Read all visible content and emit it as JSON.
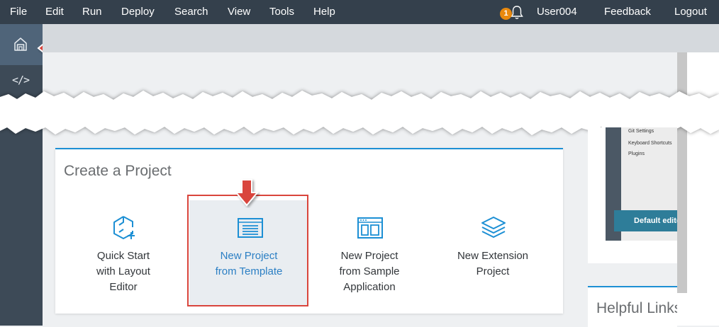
{
  "menubar": {
    "items": [
      "File",
      "Edit",
      "Run",
      "Deploy",
      "Search",
      "View",
      "Tools",
      "Help"
    ],
    "notification_count": "1",
    "user": "User004",
    "feedback": "Feedback",
    "logout": "Logout"
  },
  "rail": {
    "icons": [
      "home-icon",
      "code-icon"
    ],
    "code_glyph": "</>"
  },
  "create_project": {
    "title": "Create a Project",
    "options": [
      {
        "line1": "Quick Start",
        "line2": "with Layout",
        "line3": "Editor",
        "icon": "quick-start-icon"
      },
      {
        "line1": "New Project",
        "line2": "from Template",
        "icon": "template-icon"
      },
      {
        "line1": "New Project",
        "line2": "from Sample",
        "line3": "Application",
        "icon": "sample-app-icon"
      },
      {
        "line1": "New Extension",
        "line2": "Project",
        "icon": "layers-icon"
      }
    ]
  },
  "side_panel": {
    "menu_items": [
      "Git Settings",
      "Keyboard Shortcuts",
      "Plugins"
    ],
    "button": "Default editor",
    "helpful_links_title": "Helpful Links"
  },
  "colors": {
    "menubar": "#34404c",
    "accent": "#1c8fd4",
    "highlight": "#d9453c",
    "badge": "#e9890e"
  }
}
